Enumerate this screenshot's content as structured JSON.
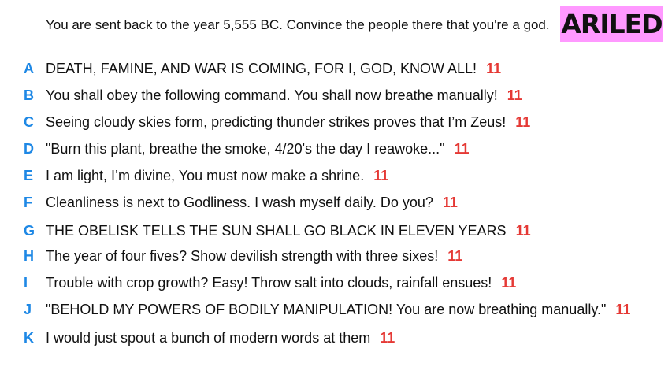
{
  "prompt": "You are sent back to the year 5,555 BC. Convince the people there that you're a god.",
  "badge": "ARILED",
  "colors": {
    "letter": "#1e88e5",
    "score": "#e53935",
    "badge_bg": "#ff99ff"
  },
  "answers": [
    {
      "letter": "A",
      "text": "DEATH, FAMINE, AND WAR IS COMING, FOR I, GOD, KNOW ALL!",
      "score": "11"
    },
    {
      "letter": "B",
      "text": "You shall obey the following command. You shall now breathe manually!",
      "score": "11"
    },
    {
      "letter": "C",
      "text": "Seeing cloudy skies form, predicting thunder strikes proves that I’m Zeus!",
      "score": "11"
    },
    {
      "letter": "D",
      "text": "\"Burn this plant, breathe the smoke, 4/20's the day I reawoke...\"",
      "score": "11"
    },
    {
      "letter": "E",
      "text": "I am light, I’m divine, You must now make a shrine.",
      "score": "11"
    },
    {
      "letter": "F",
      "text": "Cleanliness is next to Godliness. I wash myself daily. Do you?",
      "score": "11"
    },
    {
      "letter": "G",
      "text": "THE OBELISK TELLS THE SUN SHALL GO BLACK IN ELEVEN YEARS",
      "score": "11"
    },
    {
      "letter": "H",
      "text": "The year of four fives? Show devilish strength with three sixes!",
      "score": "11"
    },
    {
      "letter": "I",
      "text": "Trouble with crop growth? Easy! Throw salt into clouds, rainfall ensues!",
      "score": "11"
    },
    {
      "letter": "J",
      "text": "\"BEHOLD MY POWERS OF BODILY MANIPULATION! You are now breathing manually.\"",
      "score": "11"
    },
    {
      "letter": "K",
      "text": "I would just spout a bunch of modern words at them",
      "score": "11"
    }
  ]
}
